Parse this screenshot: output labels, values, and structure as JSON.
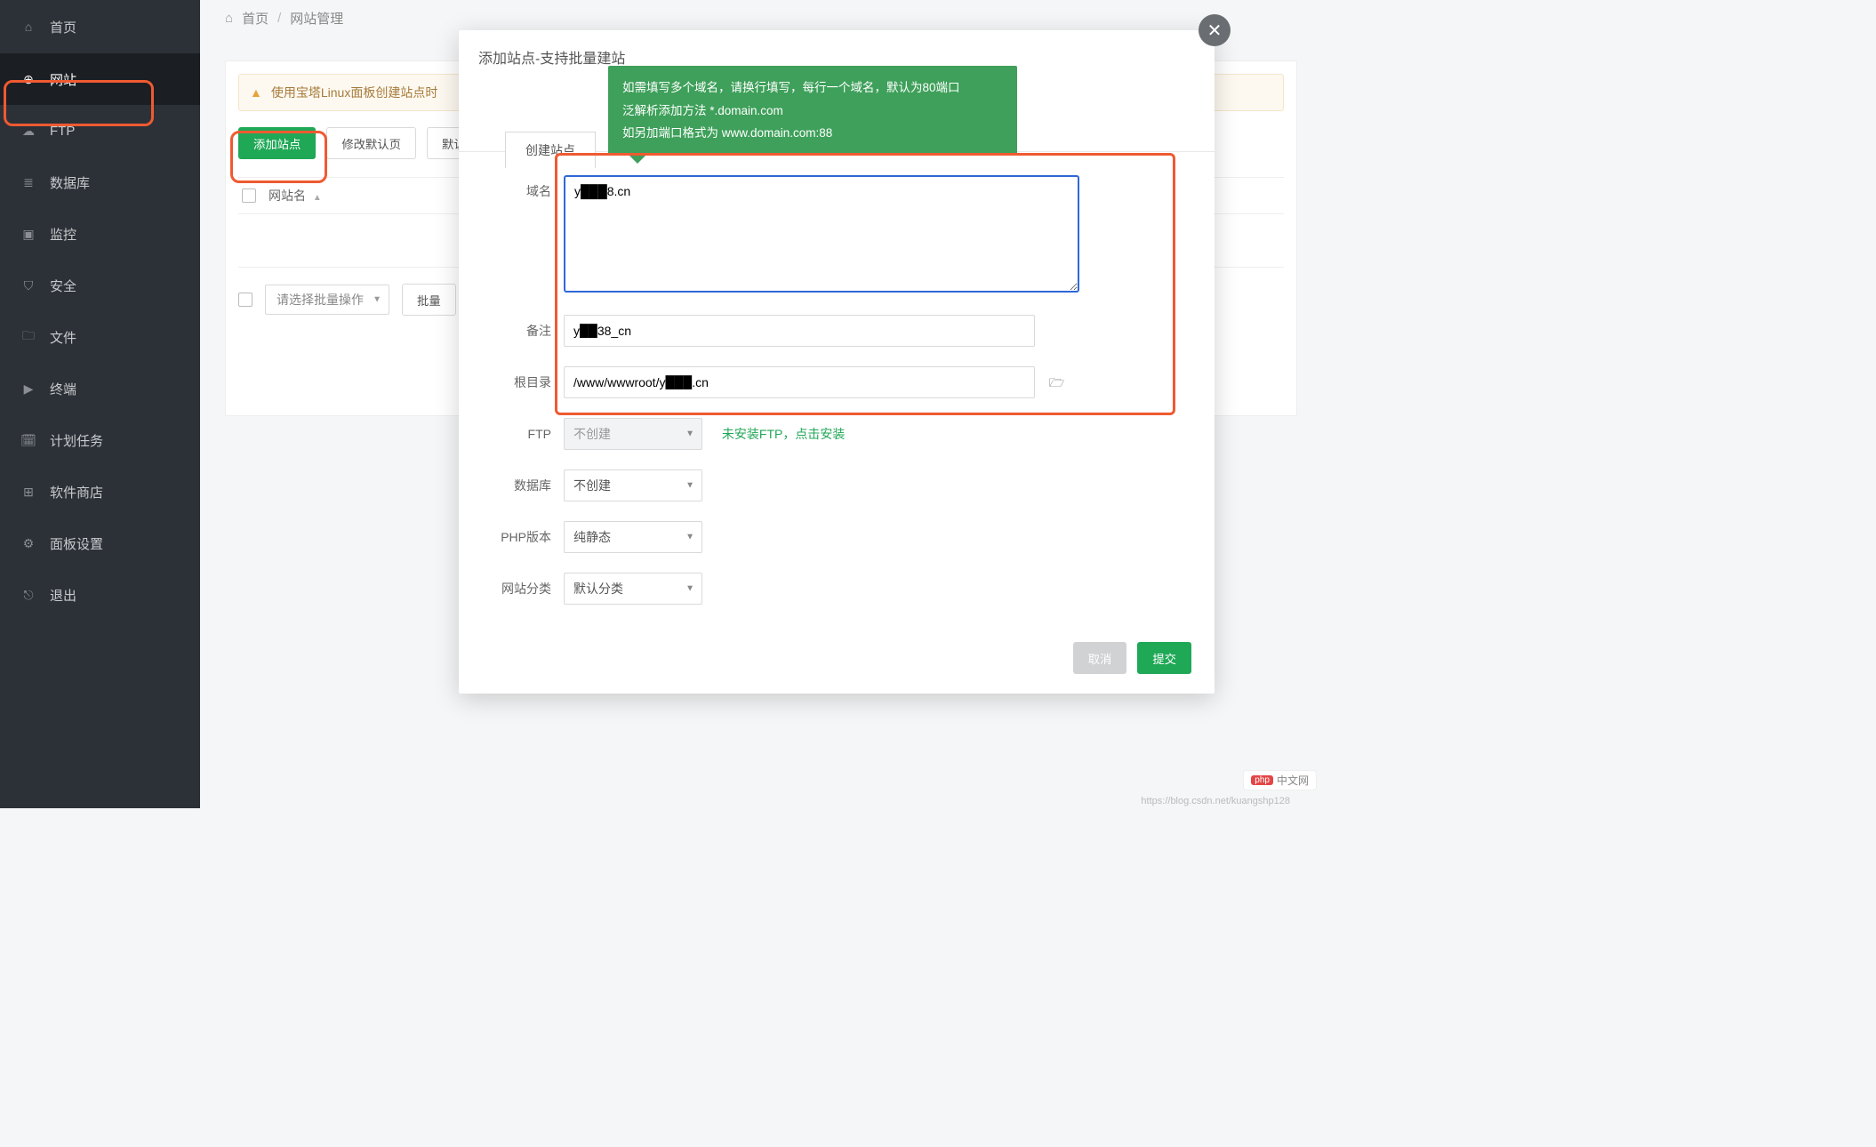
{
  "sidebar": {
    "items": [
      {
        "label": "首页",
        "icon": "⌂"
      },
      {
        "label": "网站",
        "icon": "⊕"
      },
      {
        "label": "FTP",
        "icon": "☁"
      },
      {
        "label": "数据库",
        "icon": "≣"
      },
      {
        "label": "监控",
        "icon": "▣"
      },
      {
        "label": "安全",
        "icon": "⛉"
      },
      {
        "label": "文件",
        "icon": "🗀"
      },
      {
        "label": "终端",
        "icon": "▶"
      },
      {
        "label": "计划任务",
        "icon": "🗓"
      },
      {
        "label": "软件商店",
        "icon": "⊞"
      },
      {
        "label": "面板设置",
        "icon": "⚙"
      },
      {
        "label": "退出",
        "icon": "⎋"
      }
    ]
  },
  "breadcrumb": {
    "home": "首页",
    "sep": "/",
    "current": "网站管理"
  },
  "panel": {
    "warn": "使用宝塔Linux面板创建站点时",
    "add_site": "添加站点",
    "modify_default": "修改默认页",
    "default": "默认",
    "site_name_col": "网站名",
    "batch_select": "请选择批量操作",
    "batch_btn": "批量"
  },
  "modal": {
    "title": "添加站点-支持批量建站",
    "tabs": {
      "create": "创建站点"
    },
    "tip_l1": "如需填写多个域名，请换行填写，每行一个域名，默认为80端口",
    "tip_l2": "泛解析添加方法 *.domain.com",
    "tip_l3": "如另加端口格式为 www.domain.com:88",
    "labels": {
      "domain": "域名",
      "remark": "备注",
      "root": "根目录",
      "ftp": "FTP",
      "db": "数据库",
      "php": "PHP版本",
      "category": "网站分类"
    },
    "values": {
      "domain": "y███8.cn",
      "remark": "y██38_cn",
      "root": "/www/wwwroot/y███.cn",
      "ftp": "不创建",
      "db": "不创建",
      "php": "纯静态",
      "category": "默认分类"
    },
    "ftp_hint": "未安装FTP，点击安装",
    "cancel": "取消",
    "submit": "提交"
  },
  "footer": {
    "watermark": "https://blog.csdn.net/kuangshp128",
    "badge": "中文网"
  }
}
